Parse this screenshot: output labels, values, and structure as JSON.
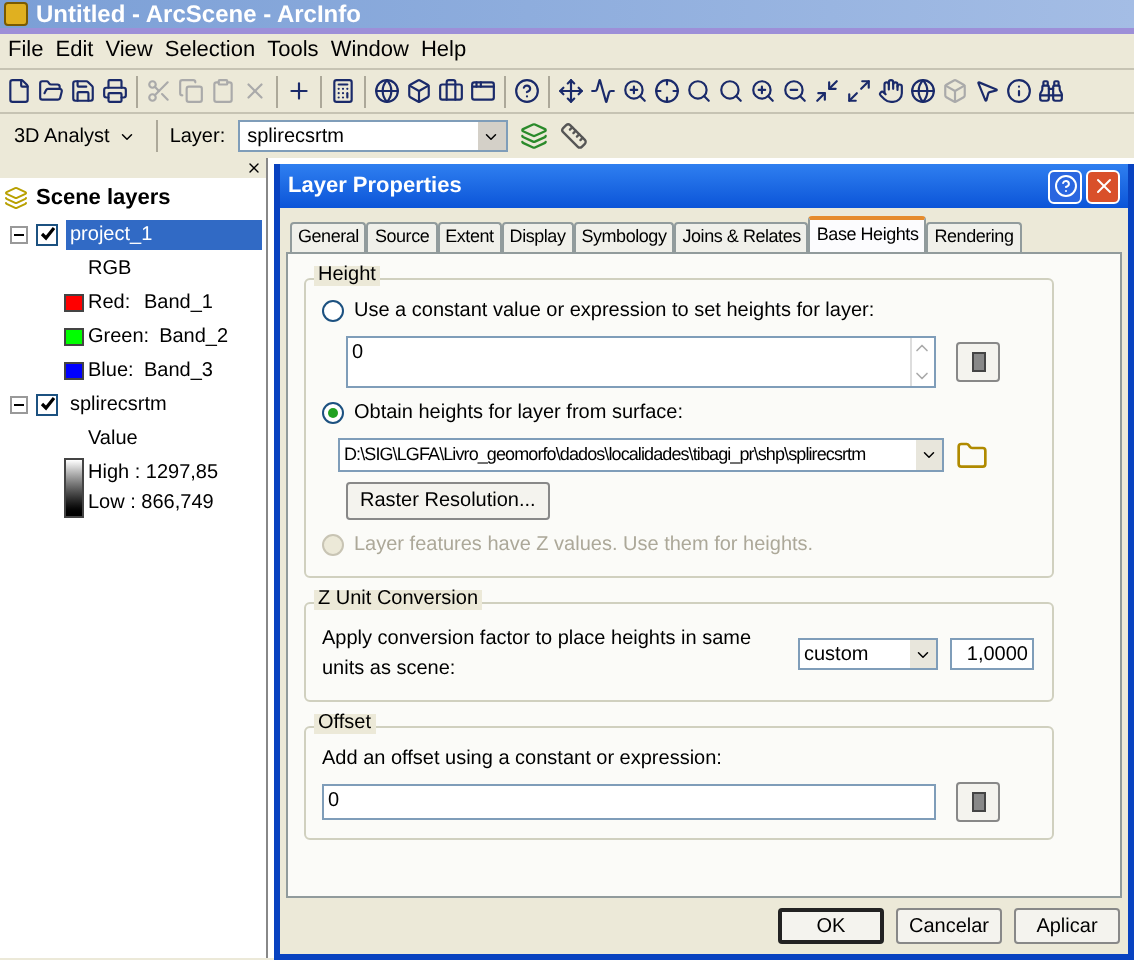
{
  "window": {
    "title": "Untitled - ArcScene - ArcInfo"
  },
  "menu": [
    "File",
    "Edit",
    "View",
    "Selection",
    "Tools",
    "Window",
    "Help"
  ],
  "analyst_toolbar": {
    "menu_label": "3D Analyst",
    "layer_label": "Layer:",
    "layer_value": "splirecsrtm"
  },
  "toc": {
    "title": "Scene layers",
    "layers": [
      {
        "name": "project_1",
        "checked": true,
        "selected": true,
        "expanded": true,
        "kind": "rgb",
        "heading": "RGB",
        "bands": [
          {
            "label": "Red:",
            "value": "Band_1",
            "color": "#ff0000"
          },
          {
            "label": "Green:",
            "value": "Band_2",
            "color": "#00ff00"
          },
          {
            "label": "Blue:",
            "value": "Band_3",
            "color": "#0000ff"
          }
        ]
      },
      {
        "name": "splirecsrtm",
        "checked": true,
        "selected": false,
        "expanded": true,
        "kind": "stretch",
        "heading": "Value",
        "high": "High : 1297,85",
        "low": "Low : 866,749"
      }
    ]
  },
  "dialog": {
    "title": "Layer Properties",
    "tabs": [
      {
        "label": "General",
        "selected": false
      },
      {
        "label": "Source",
        "selected": false
      },
      {
        "label": "Extent",
        "selected": false
      },
      {
        "label": "Display",
        "selected": false
      },
      {
        "label": "Symbology",
        "selected": false
      },
      {
        "label": "Joins & Relates",
        "selected": false
      },
      {
        "label": "Base Heights",
        "selected": true
      },
      {
        "label": "Rendering",
        "selected": false
      }
    ],
    "height": {
      "title": "Height",
      "constant": {
        "label": "Use a constant value or expression to set heights for layer:",
        "selected": false,
        "disabled": false,
        "value": "0"
      },
      "surface": {
        "label": "Obtain heights for layer from surface:",
        "selected": true,
        "disabled": false,
        "value": "D:\\SIG\\LGFA\\Livro_geomorfo\\dados\\localidades\\tibagi_pr\\shp\\splirecsrtm",
        "button": "Raster Resolution..."
      },
      "zvalues": {
        "label": "Layer features have Z values.  Use them for heights.",
        "selected": false,
        "disabled": true
      }
    },
    "z_unit": {
      "title": "Z Unit Conversion",
      "label": "Apply conversion factor to place heights in same units as scene:",
      "unit": "custom",
      "factor": "1,0000"
    },
    "offset": {
      "title": "Offset",
      "label": "Add an offset using a constant or expression:",
      "value": "0"
    },
    "buttons": [
      {
        "label": "OK",
        "default": true
      },
      {
        "label": "Cancelar",
        "default": false
      },
      {
        "label": "Aplicar",
        "default": false
      }
    ]
  }
}
